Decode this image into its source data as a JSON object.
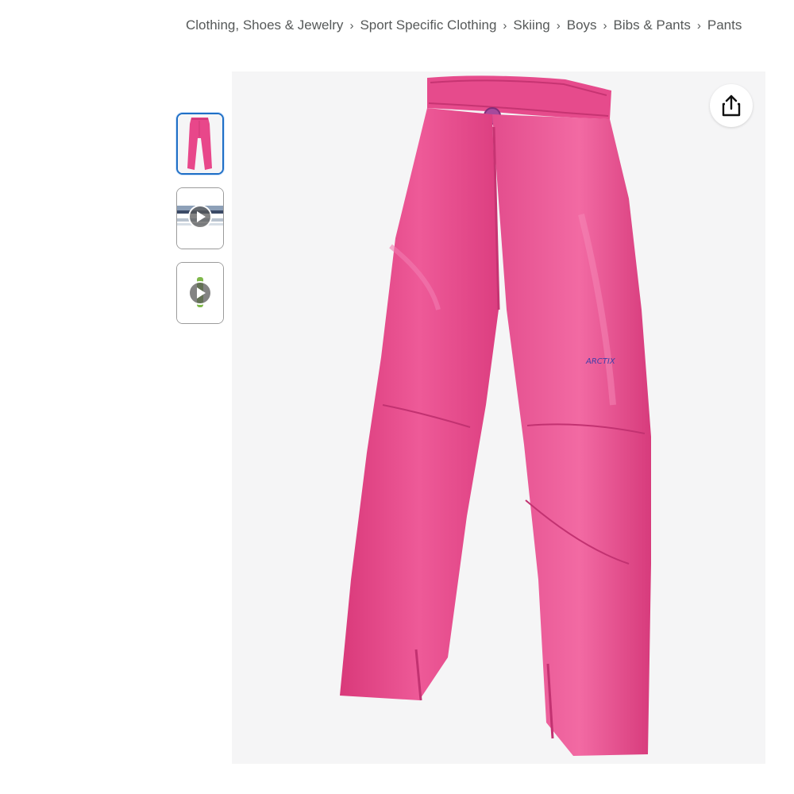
{
  "breadcrumb": {
    "items": [
      {
        "label": "Clothing, Shoes & Jewelry"
      },
      {
        "label": "Sport Specific Clothing"
      },
      {
        "label": "Skiing"
      },
      {
        "label": "Boys"
      },
      {
        "label": "Bibs & Pants"
      },
      {
        "label": "Pants"
      }
    ],
    "separator": "›"
  },
  "thumbnails": [
    {
      "kind": "image",
      "icon": "pink-pants-thumbnail",
      "selected": true
    },
    {
      "kind": "video",
      "icon": "play-icon",
      "selected": false
    },
    {
      "kind": "video",
      "icon": "play-icon",
      "selected": false
    }
  ],
  "main_image": {
    "subject": "pink-snow-pants",
    "brand_mark": "ARCTIX"
  },
  "share": {
    "icon": "share-icon"
  },
  "colors": {
    "product_pink": "#e8478a",
    "selected_border": "#1f6fc6",
    "breadcrumb_text": "#565959",
    "image_bg": "#f5f5f6"
  }
}
